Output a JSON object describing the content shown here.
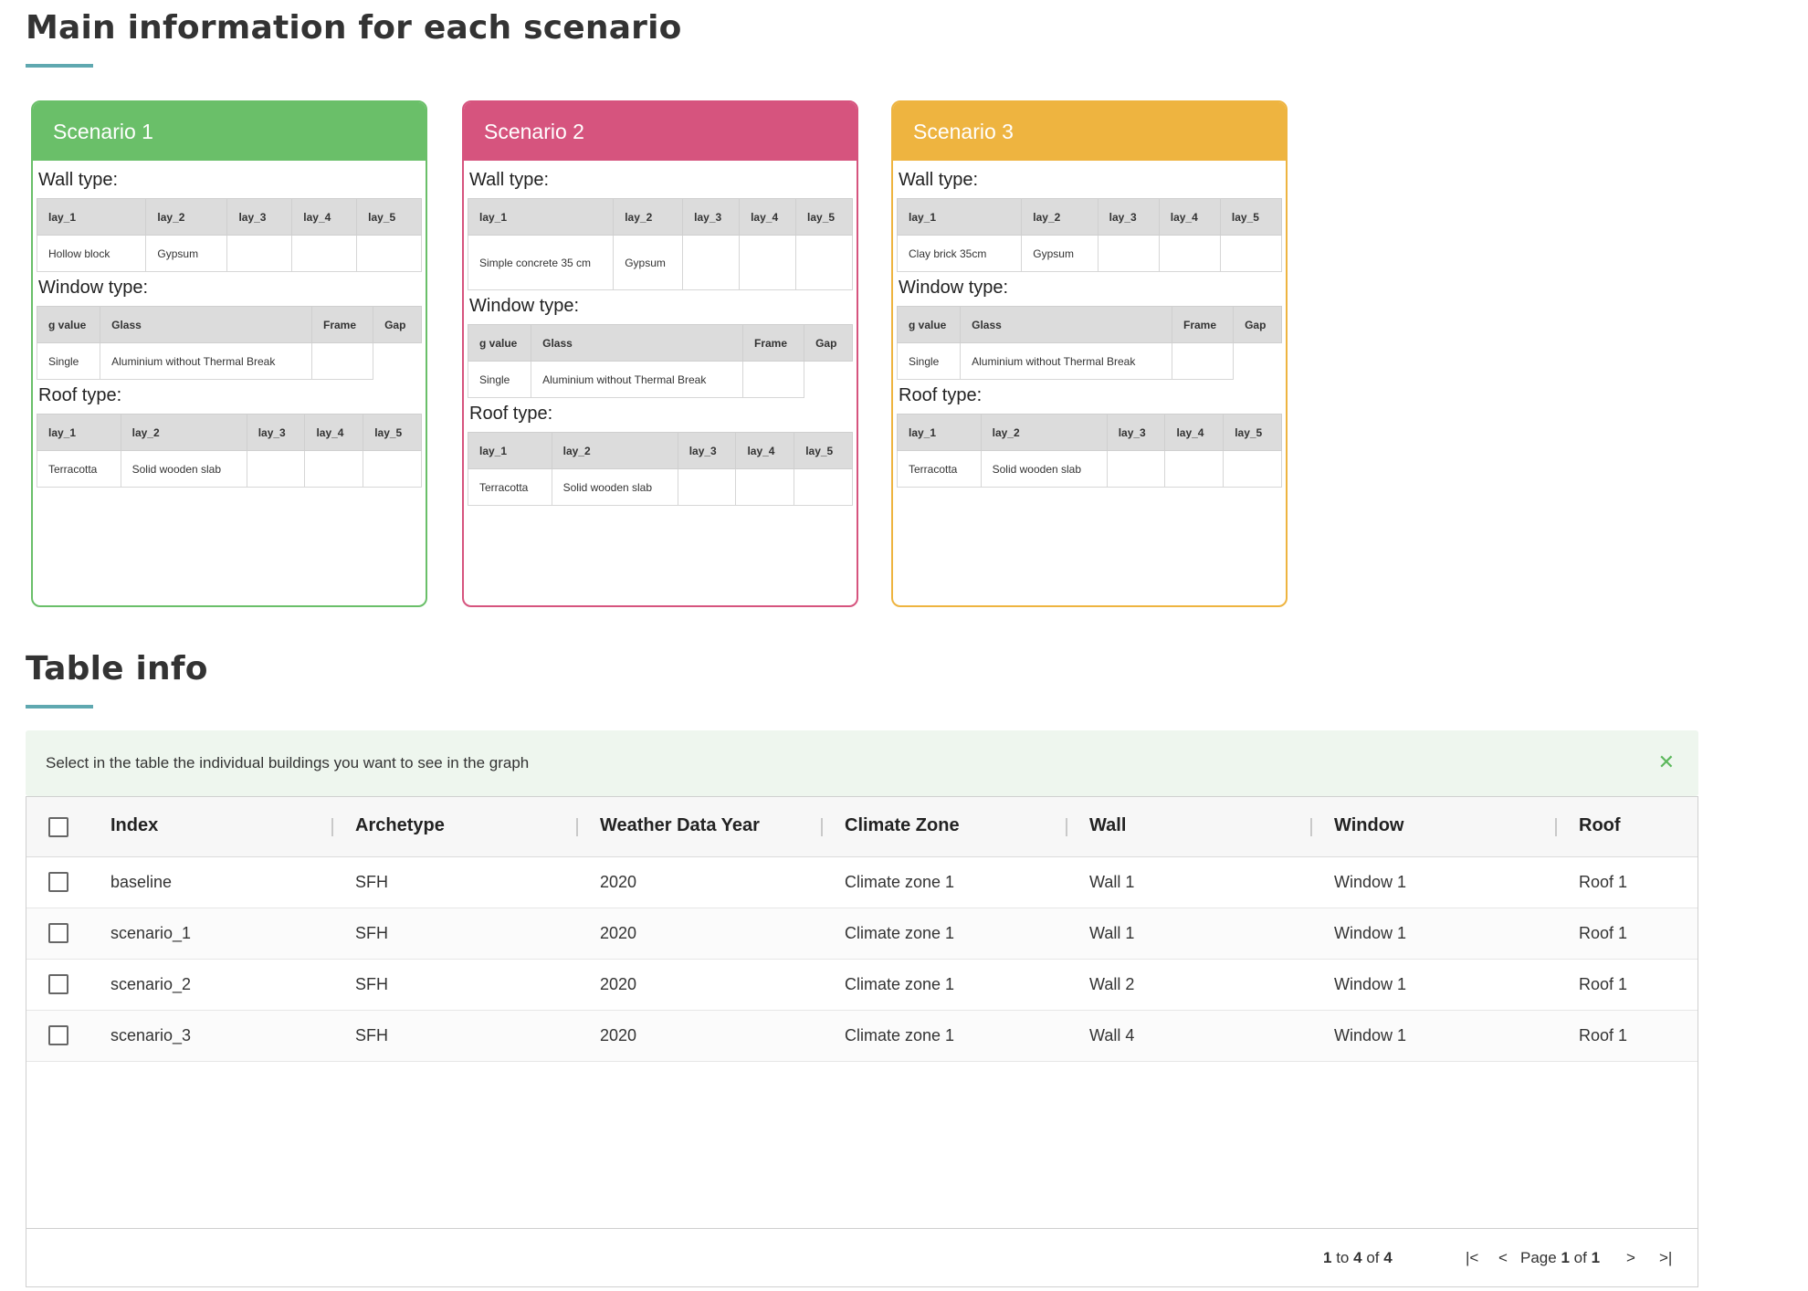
{
  "section1": {
    "title": "Main information for each scenario"
  },
  "section2": {
    "title": "Table info"
  },
  "colors": {
    "accent": "#5fa8b0",
    "scenario1": "#6abf69",
    "scenario2": "#d6547e",
    "scenario3": "#eeb440",
    "info_bg": "#eef6ee",
    "close": "#5cb85c"
  },
  "scenarios": [
    {
      "title": "Scenario 1",
      "wall_label": "Wall type:",
      "wall_headers": [
        "lay_1",
        "lay_2",
        "lay_3",
        "lay_4",
        "lay_5"
      ],
      "wall_values": [
        "Hollow block",
        "Gypsum",
        "",
        "",
        ""
      ],
      "window_label": "Window type:",
      "window_headers": [
        "g value",
        "Glass",
        "Frame",
        "Gap"
      ],
      "window_values": [
        "Single",
        "Aluminium without Thermal Break",
        "",
        ""
      ],
      "roof_label": "Roof type:",
      "roof_headers": [
        "lay_1",
        "lay_2",
        "lay_3",
        "lay_4",
        "lay_5"
      ],
      "roof_values": [
        "Terracotta",
        "Solid wooden slab",
        "",
        "",
        ""
      ]
    },
    {
      "title": "Scenario 2",
      "wall_label": "Wall type:",
      "wall_headers": [
        "lay_1",
        "lay_2",
        "lay_3",
        "lay_4",
        "lay_5"
      ],
      "wall_values": [
        "Simple concrete 35 cm",
        "Gypsum",
        "",
        "",
        ""
      ],
      "window_label": "Window type:",
      "window_headers": [
        "g value",
        "Glass",
        "Frame",
        "Gap"
      ],
      "window_values": [
        "Single",
        "Aluminium without Thermal Break",
        "",
        ""
      ],
      "roof_label": "Roof type:",
      "roof_headers": [
        "lay_1",
        "lay_2",
        "lay_3",
        "lay_4",
        "lay_5"
      ],
      "roof_values": [
        "Terracotta",
        "Solid wooden slab",
        "",
        "",
        ""
      ]
    },
    {
      "title": "Scenario 3",
      "wall_label": "Wall type:",
      "wall_headers": [
        "lay_1",
        "lay_2",
        "lay_3",
        "lay_4",
        "lay_5"
      ],
      "wall_values": [
        "Clay brick 35cm",
        "Gypsum",
        "",
        "",
        ""
      ],
      "window_label": "Window type:",
      "window_headers": [
        "g value",
        "Glass",
        "Frame",
        "Gap"
      ],
      "window_values": [
        "Single",
        "Aluminium without Thermal Break",
        "",
        ""
      ],
      "roof_label": "Roof type:",
      "roof_headers": [
        "lay_1",
        "lay_2",
        "lay_3",
        "lay_4",
        "lay_5"
      ],
      "roof_values": [
        "Terracotta",
        "Solid wooden slab",
        "",
        "",
        ""
      ]
    }
  ],
  "info_bar": {
    "text": "Select in the table the individual buildings you want to see in the graph",
    "close_icon": "close-icon"
  },
  "grid": {
    "columns": [
      "Index",
      "Archetype",
      "Weather Data Year",
      "Climate Zone",
      "Wall",
      "Window",
      "Roof"
    ],
    "rows": [
      [
        "baseline",
        "SFH",
        "2020",
        "Climate zone 1",
        "Wall 1",
        "Window 1",
        "Roof 1"
      ],
      [
        "scenario_1",
        "SFH",
        "2020",
        "Climate zone 1",
        "Wall 1",
        "Window 1",
        "Roof 1"
      ],
      [
        "scenario_2",
        "SFH",
        "2020",
        "Climate zone 1",
        "Wall 2",
        "Window 1",
        "Roof 1"
      ],
      [
        "scenario_3",
        "SFH",
        "2020",
        "Climate zone 1",
        "Wall 4",
        "Window 1",
        "Roof 1"
      ]
    ],
    "pagination": {
      "from": "1",
      "to_word": "to",
      "to": "4",
      "of_word": "of",
      "total": "4",
      "page_word": "Page",
      "page": "1",
      "page_of_word": "of",
      "pages": "1",
      "first_icon": "K<",
      "prev_icon": "<",
      "next_icon": ">",
      "last_icon": ">I"
    }
  }
}
